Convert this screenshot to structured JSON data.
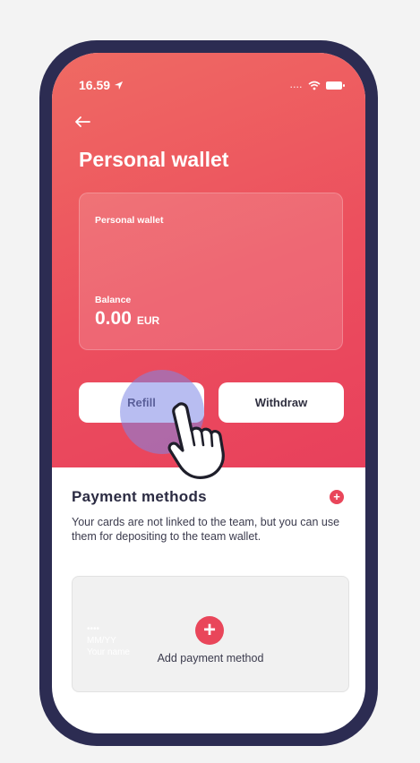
{
  "status_bar": {
    "time": "16.59",
    "signal": "...."
  },
  "header": {
    "back_icon": "arrow-left-icon",
    "title": "Personal wallet"
  },
  "wallet_card": {
    "label": "Personal wallet",
    "balance_label": "Balance",
    "amount": "0.00",
    "currency": "EUR"
  },
  "actions": {
    "refill_label": "Refill",
    "withdraw_label": "Withdraw"
  },
  "payment_methods": {
    "title": "Payment methods",
    "description": "Your cards are not linked to the team, but you can use them for depositing to the team wallet.",
    "add_label": "Add payment method",
    "ghost_dots": "••••",
    "ghost_lines": [
      "MM/YY",
      "Your name"
    ]
  },
  "colors": {
    "accent": "#e9465a",
    "hero_start": "#ef6a63",
    "hero_end": "#e8405c",
    "frame": "#2c2c52"
  }
}
